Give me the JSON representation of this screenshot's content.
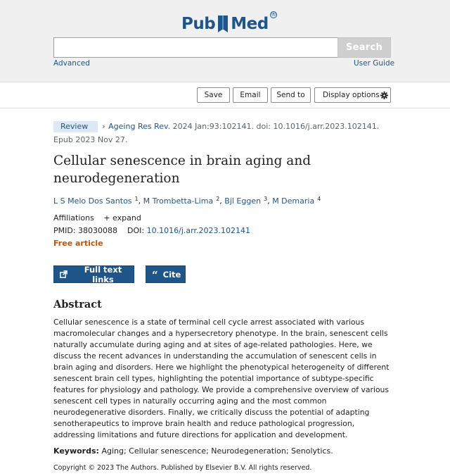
{
  "header": {
    "logo_left": "Pub",
    "logo_right": "Med",
    "logo_reg": "®",
    "search_placeholder": "",
    "search_button": "Search",
    "advanced_link": "Advanced",
    "user_guide_link": "User Guide"
  },
  "toolbar": {
    "save": "Save",
    "email": "Email",
    "send_to": "Send to",
    "display_options": "Display options"
  },
  "article": {
    "type_badge": "Review",
    "journal": "Ageing Res Rev.",
    "citation_rest": "2024 Jan:93:102141. doi: 10.1016/j.arr.2023.102141.",
    "epub": "Epub 2023 Nov 27.",
    "title": "Cellular senescence in brain aging and neurodegeneration",
    "authors": [
      {
        "name": "L S Melo Dos Santos",
        "aff": "1"
      },
      {
        "name": "M Trombetta-Lima",
        "aff": "2"
      },
      {
        "name": "Bjl Eggen",
        "aff": "3"
      },
      {
        "name": "M Demaria",
        "aff": "4"
      }
    ],
    "affiliations_label": "Affiliations",
    "expand_label": "expand",
    "pmid_label": "PMID:",
    "pmid": "38030088",
    "doi_label": "DOI:",
    "doi": "10.1016/j.arr.2023.102141",
    "free_label": "Free article"
  },
  "actions": {
    "full_text": "Full text links",
    "cite": "Cite"
  },
  "abstract": {
    "heading": "Abstract",
    "text": "Cellular senescence is a state of terminal cell cycle arrest associated with various macromolecular changes and a hypersecretory phenotype. In the brain, senescent cells naturally accumulate during aging and at sites of age-related pathologies. Here, we discuss the recent advances in understanding the accumulation of senescent cells in brain aging and disorders. Here we highlight the phenotypical heterogeneity of different senescent brain cell types, highlighting the potential importance of subtype-specific features for physiology and pathology. We provide a comprehensive overview of various senescent cell types in naturally occurring aging and the most common neurodegenerative disorders. Finally, we critically discuss the potential of adapting senotherapeutics to improve brain health and reduce pathological progression, addressing limitations and future directions for application and development.",
    "keywords_label": "Keywords:",
    "keywords": "Aging; Cellular senescence; Neurodegeneration; Senolytics.",
    "copyright": "Copyright © 2023 The Authors. Published by Elsevier B.V. All rights reserved."
  },
  "colors": {
    "brand_blue": "#20558a",
    "free_orange": "#b85610",
    "badge_bg": "#dce8f5",
    "header_bg": "#f0f0f0"
  },
  "icons": [
    "pubmed-logo-mark",
    "gear-icon",
    "chevron-right-icon",
    "plus-icon",
    "external-link-icon",
    "quote-icon"
  ]
}
